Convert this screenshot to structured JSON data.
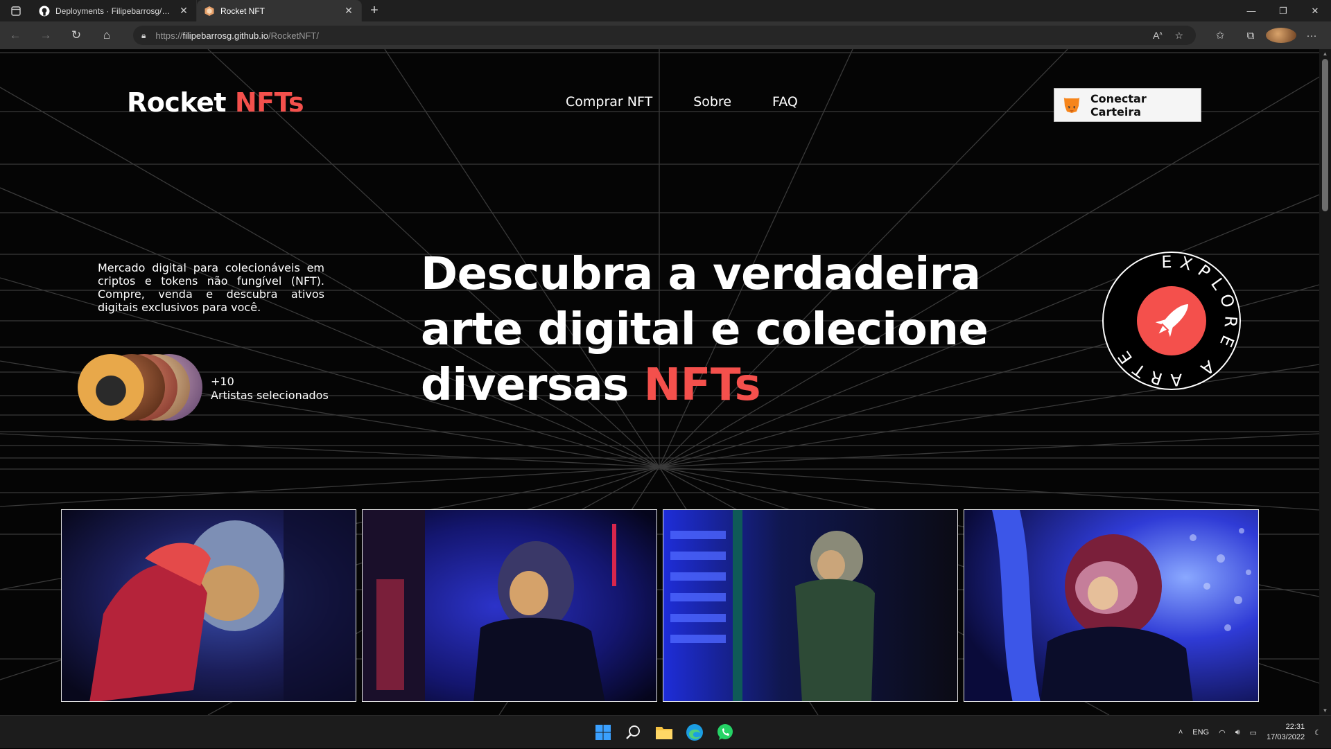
{
  "browser": {
    "tabs": [
      {
        "title": "Deployments · Filipebarrosg/Roc",
        "icon": "github-icon",
        "active": false
      },
      {
        "title": "Rocket NFT",
        "icon": "rocket-favicon",
        "active": true
      }
    ],
    "address": {
      "scheme": "https://",
      "host": "filipebarrosg.github.io",
      "path": "/RocketNFT/"
    }
  },
  "page": {
    "logo": {
      "main": "Rocket ",
      "accent": "NFTs"
    },
    "nav": [
      {
        "label": "Comprar NFT"
      },
      {
        "label": "Sobre"
      },
      {
        "label": "FAQ"
      }
    ],
    "wallet_button": "Conectar Carteira",
    "intro": "Mercado digital para colecionáveis em criptos e tokens não fungível (NFT). Compre, venda e descubra ativos digitais exclusivos para você.",
    "artists": {
      "count": "+10",
      "label": "Artistas selecionados"
    },
    "headline": {
      "line1": "Descubra a verdadeira",
      "line2": "arte digital e colecione",
      "line3_main": "diversas ",
      "line3_accent": "NFTs"
    },
    "badge_text": "EXPLORE A ARTE",
    "accent_color": "#f4504c",
    "gallery": [
      {
        "name": "astronaut-red-helmet"
      },
      {
        "name": "astronaut-blue-room"
      },
      {
        "name": "astronaut-green-suit"
      },
      {
        "name": "astronaut-helmet-lights"
      }
    ]
  },
  "taskbar": {
    "language": "ENG",
    "time": "22:31",
    "date": "17/03/2022"
  }
}
